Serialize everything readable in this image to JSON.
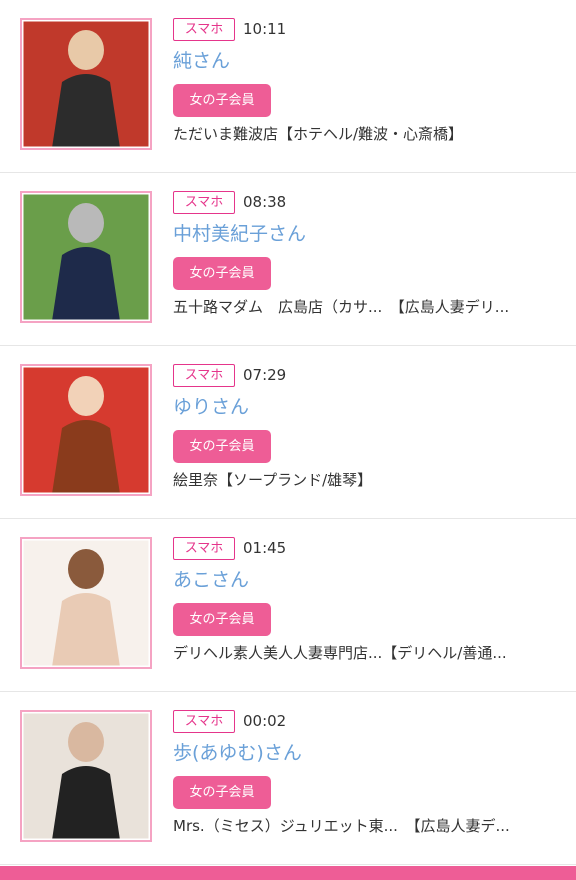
{
  "items": [
    {
      "device": "スマホ",
      "time": "10:11",
      "name": "純さん",
      "badge": "女の子会員",
      "shop": "ただいま難波店【ホテヘル/難波・心斎橋】",
      "thumb_colors": [
        "#c0392b",
        "#2c2c2c",
        "#e8c9a8"
      ]
    },
    {
      "device": "スマホ",
      "time": "08:38",
      "name": "中村美紀子さん",
      "badge": "女の子会員",
      "shop": "五十路マダム　広島店（カサ...　【広島人妻デリ...",
      "thumb_colors": [
        "#6a9e4a",
        "#1e2a4a",
        "#b9b9b9"
      ]
    },
    {
      "device": "スマホ",
      "time": "07:29",
      "name": "ゆりさん",
      "badge": "女の子会員",
      "shop": "絵里奈【ソープランド/雄琴】",
      "thumb_colors": [
        "#d63a2f",
        "#8a3b1c",
        "#f2d2b8"
      ]
    },
    {
      "device": "スマホ",
      "time": "01:45",
      "name": "あこさん",
      "badge": "女の子会員",
      "shop": "デリヘル素人美人人妻専門店...【デリヘル/善通...",
      "thumb_colors": [
        "#f7f1ec",
        "#e9cbb5",
        "#8a5a3c"
      ]
    },
    {
      "device": "スマホ",
      "time": "00:02",
      "name": "歩(あゆむ)さん",
      "badge": "女の子会員",
      "shop": "Mrs.（ミセス）ジュリエット東...　【広島人妻デ...",
      "thumb_colors": [
        "#e9e2da",
        "#222222",
        "#d9b8a0"
      ]
    }
  ],
  "bottom_bar_text": ""
}
